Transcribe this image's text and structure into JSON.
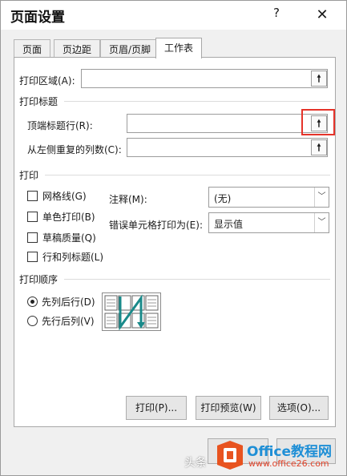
{
  "dialog": {
    "title": "页面设置",
    "help_label": "?",
    "close_label": "✕"
  },
  "tabs": [
    "页面",
    "页边距",
    "页眉/页脚",
    "工作表"
  ],
  "print_area": {
    "label": "打印区域(A):",
    "value": ""
  },
  "print_titles": {
    "section": "打印标题",
    "rows_label": "顶端标题行(R):",
    "rows_value": "",
    "cols_label": "从左侧重复的列数(C):",
    "cols_value": ""
  },
  "print": {
    "section": "打印",
    "gridlines": "网格线(G)",
    "black_white": "单色打印(B)",
    "draft": "草稿质量(Q)",
    "row_col_headings": "行和列标题(L)",
    "comments_label": "注释(M):",
    "comments_value": "(无)",
    "errors_label": "错误单元格打印为(E):",
    "errors_value": "显示值"
  },
  "page_order": {
    "section": "打印顺序",
    "down_then_over": "先列后行(D)",
    "over_then_down": "先行后列(V)",
    "selected": "down_then_over"
  },
  "buttons": {
    "print": "打印(P)...",
    "preview": "打印预览(W)",
    "options": "选项(O)..."
  },
  "watermark": {
    "prefix": "头条",
    "name": "Office教程网",
    "url": "www.office26.com"
  },
  "colors": {
    "highlight": "#e5332a",
    "watermark_blue": "#1f8fd6",
    "watermark_orange": "#e8531f"
  }
}
